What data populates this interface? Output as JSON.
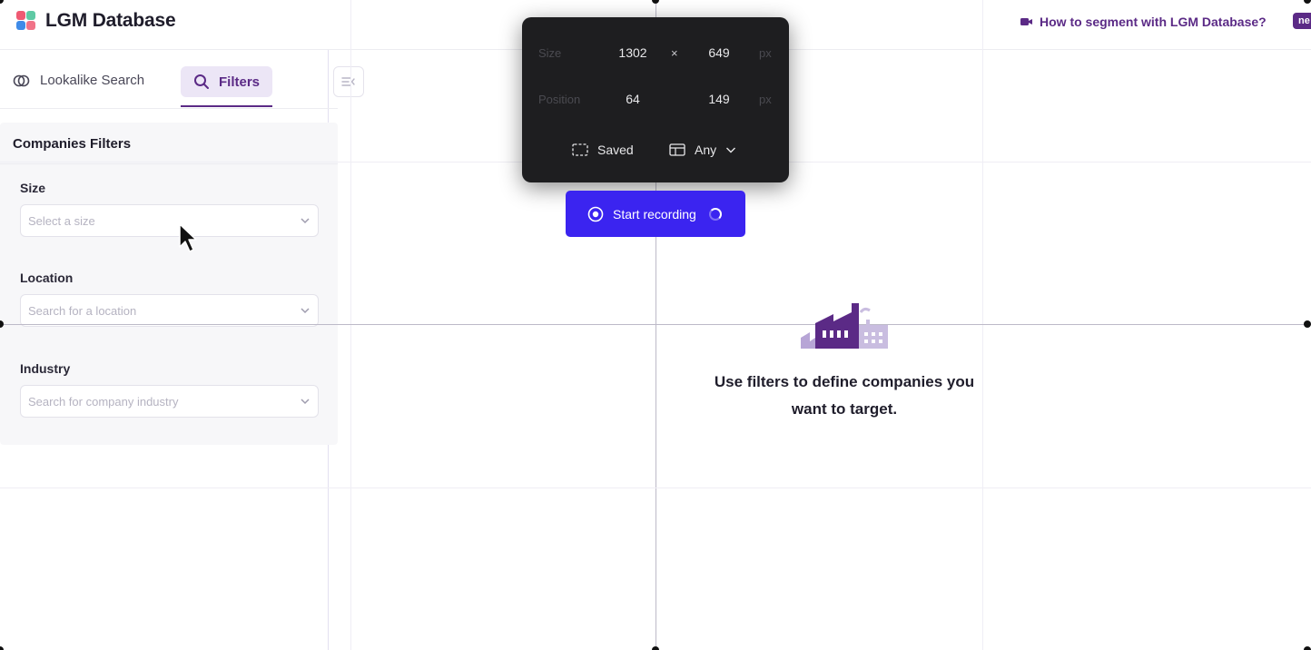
{
  "app": {
    "title": "LGM Database",
    "logo_colors": [
      "#ef5a73",
      "#5fc9a4",
      "#3f8be8",
      "#f6b73c"
    ]
  },
  "header": {
    "help_link_label": "How to segment with LGM Database?",
    "badge_label": "ne"
  },
  "sidebar": {
    "tabs": [
      {
        "label": "Lookalike Search",
        "icon": "lookalike-icon",
        "active": false
      },
      {
        "label": "Filters",
        "icon": "search-icon",
        "active": true
      }
    ],
    "panel_title": "Companies Filters",
    "filters": [
      {
        "label": "Size",
        "placeholder": "Select a size"
      },
      {
        "label": "Location",
        "placeholder": "Search for a location"
      },
      {
        "label": "Industry",
        "placeholder": "Search for company industry"
      }
    ]
  },
  "recorder": {
    "size_label": "Size",
    "width": "1302",
    "times": "×",
    "height": "649",
    "unit": "px",
    "position_label": "Position",
    "pos_x": "64",
    "pos_y": "149",
    "saved_label": "Saved",
    "any_label": "Any",
    "start_label": "Start recording"
  },
  "empty_state": {
    "line1": "Use filters to define companies you",
    "line2": "want to target.",
    "icon": "factory-icon"
  },
  "colors": {
    "brand": "#5b2a86",
    "record_button": "#3b24f0",
    "guide_line": "#d7d3ee"
  }
}
